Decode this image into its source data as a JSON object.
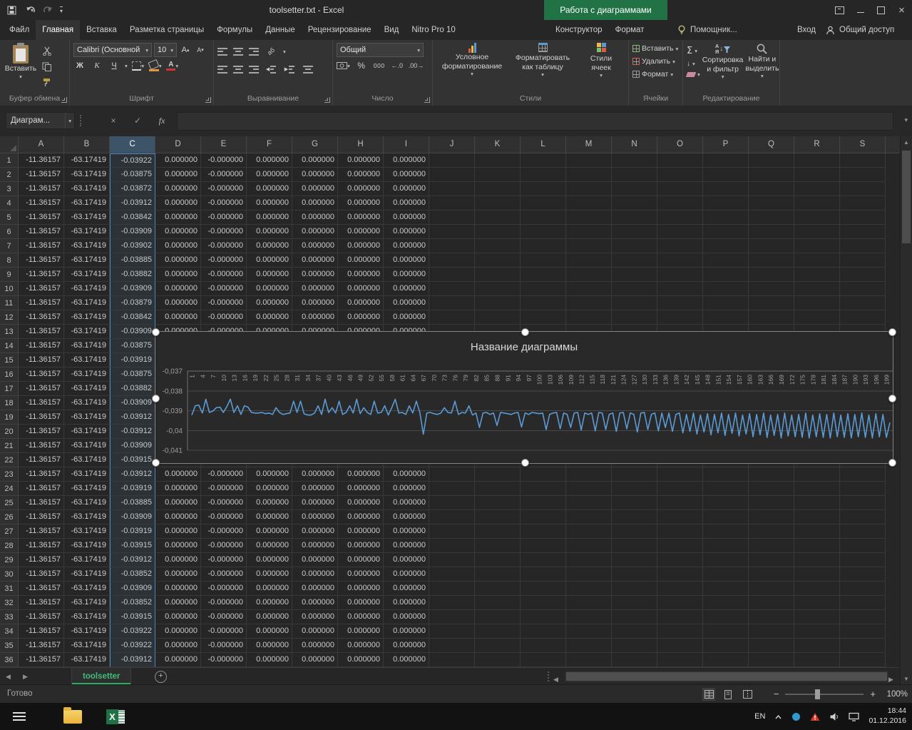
{
  "titlebar": {
    "title": "toolsetter.txt - Excel",
    "context_group": "Работа с диаграммами"
  },
  "tabs": {
    "items": [
      "Файл",
      "Главная",
      "Вставка",
      "Разметка страницы",
      "Формулы",
      "Данные",
      "Рецензирование",
      "Вид",
      "Nitro Pro 10"
    ],
    "active": "Главная",
    "context_items": [
      "Конструктор",
      "Формат"
    ],
    "assistant": "Помощник...",
    "sign_in": "Вход",
    "share": "Общий доступ"
  },
  "ribbon": {
    "clipboard": {
      "label": "Буфер обмена",
      "paste": "Вставить"
    },
    "font": {
      "label": "Шрифт",
      "name": "Calibri (Основной",
      "size": "10",
      "bold": "Ж",
      "italic": "К",
      "underline": "Ч"
    },
    "alignment": {
      "label": "Выравнивание"
    },
    "number": {
      "label": "Число",
      "format": "Общий"
    },
    "styles": {
      "label": "Стили",
      "conditional": "Условное форматирование",
      "as_table": "Форматировать как таблицу",
      "cell_styles": "Стили ячеек"
    },
    "cells": {
      "label": "Ячейки",
      "insert": "Вставить",
      "delete": "Удалить",
      "format": "Формат"
    },
    "editing": {
      "label": "Редактирование",
      "sort": "Сортировка и фильтр",
      "find": "Найти и выделить"
    }
  },
  "formula_bar": {
    "name_box": "Диаграм...",
    "fx": "fx"
  },
  "grid": {
    "columns": [
      "A",
      "B",
      "C",
      "D",
      "E",
      "F",
      "G",
      "H",
      "I",
      "J",
      "K",
      "L",
      "M",
      "N",
      "O",
      "P",
      "Q",
      "R",
      "S"
    ],
    "row_count": 36,
    "selected_column": "C",
    "values": {
      "A": "-11.36157",
      "B": "-63.17419",
      "C": [
        "-0.03922",
        "-0.03875",
        "-0.03872",
        "-0.03912",
        "-0.03842",
        "-0.03909",
        "-0.03902",
        "-0.03885",
        "-0.03882",
        "-0.03909",
        "-0.03879",
        "-0.03842",
        "-0.03909",
        "-0.03875",
        "-0.03919",
        "-0.03875",
        "-0.03882",
        "-0.03909",
        "-0.03912",
        "-0.03912",
        "-0.03909",
        "-0.03915",
        "-0.03912",
        "-0.03919",
        "-0.03885",
        "-0.03909",
        "-0.03919",
        "-0.03915",
        "-0.03912",
        "-0.03852",
        "-0.03909",
        "-0.03852",
        "-0.03915",
        "-0.03922",
        "-0.03922",
        "-0.03912"
      ],
      "D": "0.000000",
      "E": "-0.000000",
      "F": "0.000000",
      "G": "0.000000",
      "H": "0.000000",
      "I": "0.000000"
    }
  },
  "chart_data": {
    "type": "line",
    "title": "Название диаграммы",
    "xlabel": "",
    "ylabel": "",
    "ylim": [
      -0.041,
      -0.037
    ],
    "line_color": "#5b9bd5",
    "legend": "none",
    "grid": true,
    "y_ticks": [
      {
        "label": "-0,037",
        "value": -0.037
      },
      {
        "label": "-0,038",
        "value": -0.038
      },
      {
        "label": "-0,039",
        "value": -0.039
      },
      {
        "label": "-0,04",
        "value": -0.04
      },
      {
        "label": "-0,041",
        "value": -0.041
      }
    ],
    "x_tick_labels": [
      1,
      4,
      7,
      10,
      13,
      16,
      19,
      22,
      25,
      28,
      31,
      34,
      37,
      40,
      43,
      46,
      49,
      52,
      55,
      58,
      61,
      64,
      67,
      70,
      73,
      76,
      79,
      82,
      85,
      88,
      91,
      94,
      97,
      100,
      103,
      106,
      109,
      112,
      115,
      118,
      121,
      124,
      127,
      130,
      133,
      136,
      139,
      142,
      145,
      148,
      151,
      154,
      157,
      160,
      163,
      166,
      169,
      172,
      175,
      178,
      181,
      184,
      187,
      190,
      193,
      196,
      199
    ],
    "values": [
      -0.03922,
      -0.03875,
      -0.03872,
      -0.03912,
      -0.03842,
      -0.03909,
      -0.03902,
      -0.03885,
      -0.03882,
      -0.03909,
      -0.03879,
      -0.03842,
      -0.03909,
      -0.03875,
      -0.03919,
      -0.03875,
      -0.03882,
      -0.03909,
      -0.03912,
      -0.03912,
      -0.03909,
      -0.03915,
      -0.03912,
      -0.03919,
      -0.03885,
      -0.03909,
      -0.03919,
      -0.03915,
      -0.03912,
      -0.03852,
      -0.03909,
      -0.03852,
      -0.03915,
      -0.03922,
      -0.03922,
      -0.03912,
      -0.03875,
      -0.03919,
      -0.03842,
      -0.03909,
      -0.03885,
      -0.03912,
      -0.03852,
      -0.03919,
      -0.03909,
      -0.03875,
      -0.03912,
      -0.03842,
      -0.03915,
      -0.03885,
      -0.03909,
      -0.03919,
      -0.03852,
      -0.03912,
      -0.03909,
      -0.03875,
      -0.03922,
      -0.03885,
      -0.03842,
      -0.03912,
      -0.03909,
      -0.03919,
      -0.03875,
      -0.03912,
      -0.03852,
      -0.03909,
      -0.04019,
      -0.03912,
      -0.03909,
      -0.03915,
      -0.03919,
      -0.03912,
      -0.03885,
      -0.03909,
      -0.03912,
      -0.03852,
      -0.03919,
      -0.03909,
      -0.03912,
      -0.03875,
      -0.03922,
      -0.03912,
      -0.03985,
      -0.03912,
      -0.03909,
      -0.03919,
      -0.03912,
      -0.03975,
      -0.03909,
      -0.03912,
      -0.03915,
      -0.03919,
      -0.03912,
      -0.03909,
      -0.03982,
      -0.03912,
      -0.03919,
      -0.03909,
      -0.03912,
      -0.03915,
      -0.03912,
      -0.03995,
      -0.03919,
      -0.03912,
      -0.03909,
      -0.03992,
      -0.03912,
      -0.03919,
      -0.03985,
      -0.03912,
      -0.03909,
      -0.03998,
      -0.03912,
      -0.03919,
      -0.03912,
      -0.04002,
      -0.03909,
      -0.03912,
      -0.03995,
      -0.03919,
      -0.03912,
      -0.04005,
      -0.03912,
      -0.03909,
      -0.03992,
      -0.03912,
      -0.03919,
      -0.04008,
      -0.03912,
      -0.03909,
      -0.03995,
      -0.03919,
      -0.03912,
      -0.04002,
      -0.03912,
      -0.03985,
      -0.03912,
      -0.04005,
      -0.03919,
      -0.03912,
      -0.04012,
      -0.03919,
      -0.04005,
      -0.03912,
      -0.04018,
      -0.03922,
      -0.04008,
      -0.03915,
      -0.04022,
      -0.03919,
      -0.04012,
      -0.03912,
      -0.04025,
      -0.03919,
      -0.04015,
      -0.03912,
      -0.04028,
      -0.03922,
      -0.04018,
      -0.03915,
      -0.04032,
      -0.03919,
      -0.04022,
      -0.03912,
      -0.04035,
      -0.03922,
      -0.04025,
      -0.03919,
      -0.04038,
      -0.03912,
      -0.04028,
      -0.03922,
      -0.04032,
      -0.03919,
      -0.04035,
      -0.03912,
      -0.04038,
      -0.03922,
      -0.04032,
      -0.03915,
      -0.04035,
      -0.03919,
      -0.04038,
      -0.03912,
      -0.04032,
      -0.03922,
      -0.04035,
      -0.03915,
      -0.04038,
      -0.03919,
      -0.04032,
      -0.03912,
      -0.04035,
      -0.03922,
      -0.04038,
      -0.03915,
      -0.04032,
      -0.03919,
      -0.04035,
      -0.0396
    ]
  },
  "sheet": {
    "active": "toolsetter",
    "new_sheet": "+"
  },
  "status": {
    "ready": "Готово",
    "zoom": "100%"
  },
  "taskbar": {
    "language": "EN",
    "time": "18:44",
    "date": "01.12.2016"
  }
}
